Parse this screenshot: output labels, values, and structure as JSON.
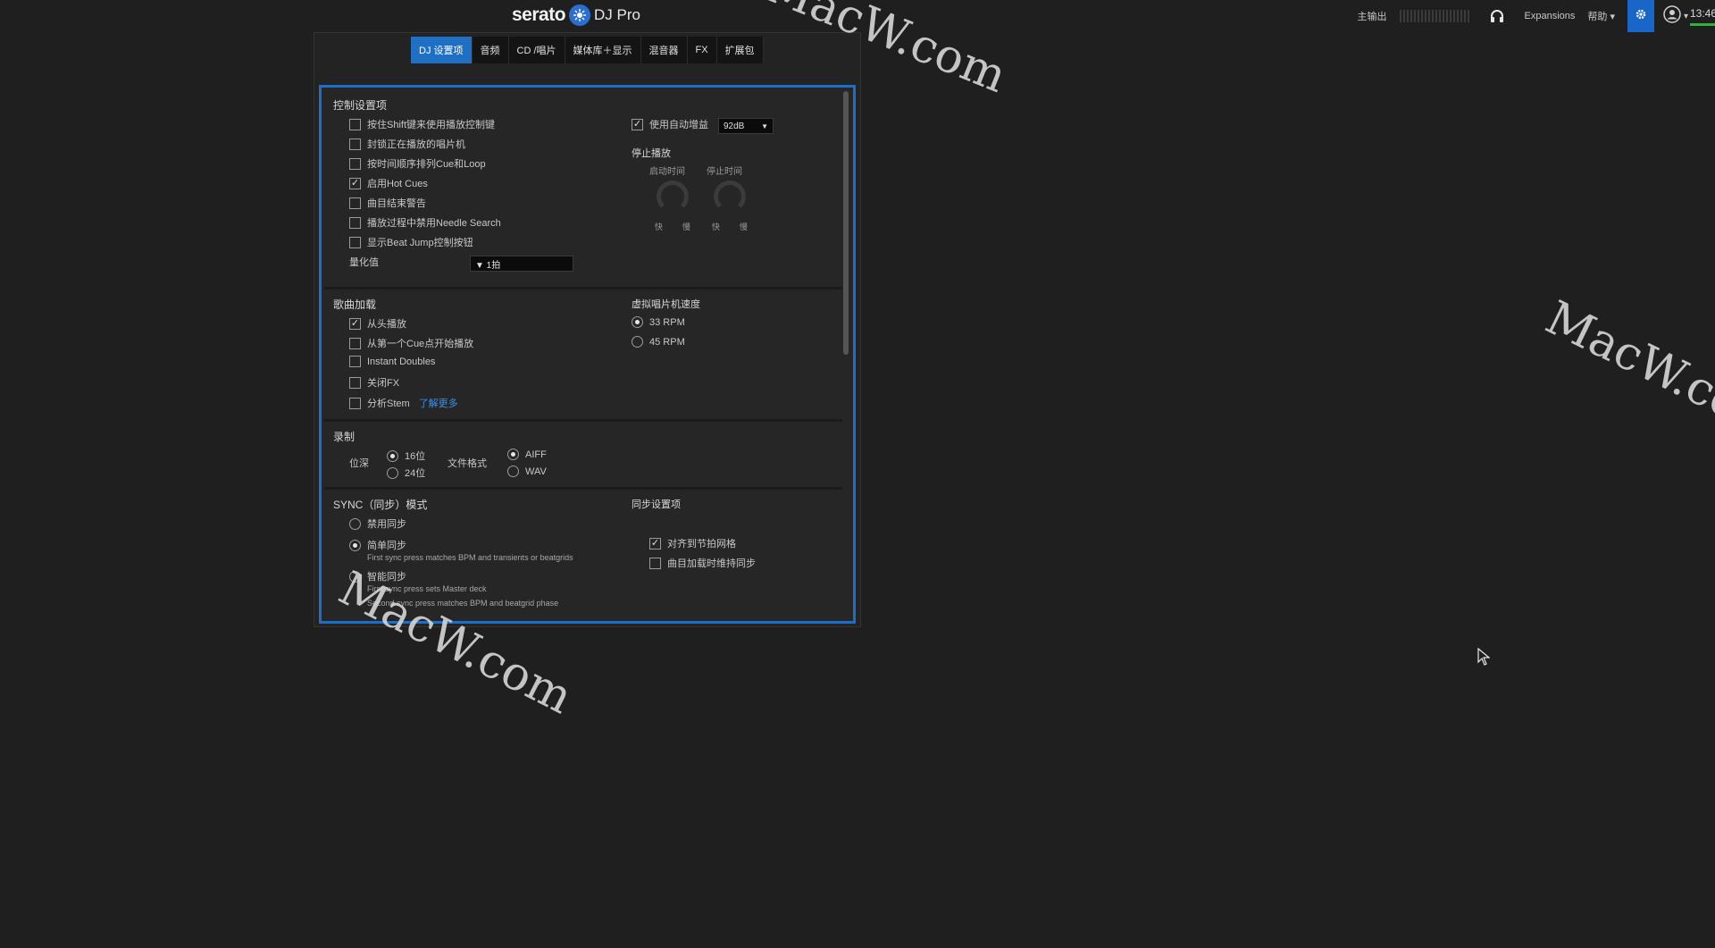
{
  "app": {
    "brand": "serato",
    "product": "DJ Pro"
  },
  "topbar": {
    "master_out": "主输出",
    "expansions": "Expansions",
    "help": "帮助",
    "clock": "13:46"
  },
  "tabs": [
    {
      "label": "DJ 设置项",
      "active": true
    },
    {
      "label": "音频"
    },
    {
      "label": "CD /唱片"
    },
    {
      "label": "媒体库＋显示"
    },
    {
      "label": "混音器"
    },
    {
      "label": "FX"
    },
    {
      "label": "扩展包"
    }
  ],
  "control": {
    "title": "控制设置项",
    "options": [
      {
        "label": "按住Shift键来使用播放控制键",
        "checked": false
      },
      {
        "label": "封锁正在播放的唱片机",
        "checked": false
      },
      {
        "label": "按时间顺序排列Cue和Loop",
        "checked": false
      },
      {
        "label": "启用Hot Cues",
        "checked": true
      },
      {
        "label": "曲目结束警告",
        "checked": false
      },
      {
        "label": "播放过程中禁用Needle Search",
        "checked": false
      },
      {
        "label": "显示Beat Jump控制按钮",
        "checked": false
      }
    ],
    "quantize_label": "量化值",
    "quantize_value": "▼ 1拍",
    "auto_gain_label": "使用自动增益",
    "auto_gain_checked": true,
    "auto_gain_value": "92dB",
    "stop_title": "停止播放",
    "start_time": "启动时间",
    "stop_time": "停止时间",
    "fast": "快",
    "slow": "慢"
  },
  "load": {
    "title": "歌曲加载",
    "options": [
      {
        "label": "从头播放",
        "checked": true
      },
      {
        "label": "从第一个Cue点开始播放",
        "checked": false
      },
      {
        "label": "Instant Doubles",
        "checked": false
      },
      {
        "label": "关闭FX",
        "checked": false
      },
      {
        "label": "分析Stem",
        "checked": false
      }
    ],
    "learn_more": "了解更多",
    "vinyl_title": "虚拟唱片机速度",
    "rpm": [
      {
        "label": "33 RPM",
        "selected": true
      },
      {
        "label": "45 RPM",
        "selected": false
      }
    ]
  },
  "record": {
    "title": "录制",
    "bit_depth_label": "位深",
    "bit_depths": [
      {
        "label": "16位",
        "selected": true
      },
      {
        "label": "24位",
        "selected": false
      }
    ],
    "format_label": "文件格式",
    "formats": [
      {
        "label": "AIFF",
        "selected": true
      },
      {
        "label": "WAV",
        "selected": false
      }
    ]
  },
  "sync": {
    "title": "SYNC（同步）模式",
    "modes": [
      {
        "label": "禁用同步",
        "selected": false
      },
      {
        "label": "简单同步",
        "selected": true,
        "desc": "First sync press matches BPM and transients or beatgrids"
      },
      {
        "label": "智能同步",
        "selected": false,
        "desc": "First sync press sets Master deck",
        "desc2": "Second sync press matches BPM and beatgrid phase"
      }
    ],
    "settings_title": "同步设置项",
    "settings": [
      {
        "label": "对齐到节拍网格",
        "checked": true
      },
      {
        "label": "曲目加载时维持同步",
        "checked": false
      }
    ]
  },
  "watermark": "MacW.com"
}
